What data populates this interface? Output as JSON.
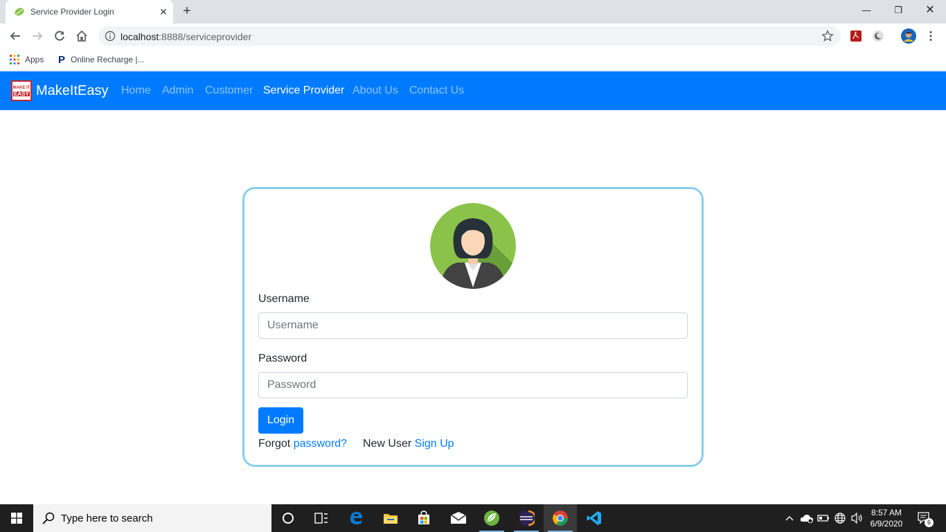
{
  "browser": {
    "tab_title": "Service Provider Login",
    "url_host": "localhost",
    "url_rest": ":8888/serviceprovider",
    "bookmarks": [
      {
        "label": "Apps"
      },
      {
        "label": "Online Recharge |..."
      }
    ]
  },
  "navbar": {
    "brand": "MakeItEasy",
    "logo_text_top": "MAKE IT",
    "logo_text_bottom": "EASY",
    "links": [
      {
        "label": "Home",
        "active": false
      },
      {
        "label": "Admin",
        "active": false
      },
      {
        "label": "Customer",
        "active": false
      },
      {
        "label": "Service Provider",
        "active": true
      },
      {
        "label": "About Us",
        "active": false
      },
      {
        "label": "Contact Us",
        "active": false
      }
    ]
  },
  "login": {
    "username_label": "Username",
    "username_placeholder": "Username",
    "username_value": "",
    "password_label": "Password",
    "password_placeholder": "Password",
    "password_value": "",
    "login_button": "Login",
    "forgot_prefix": "Forgot ",
    "forgot_link": "password?",
    "new_user_prefix": "New User ",
    "signup_link": "Sign Up"
  },
  "taskbar": {
    "search_placeholder": "Type here to search",
    "time": "8:57 AM",
    "date": "6/9/2020",
    "notification_count": "6"
  },
  "colors": {
    "navbar": "#007bff",
    "card_border": "#87ceeb",
    "link": "#007bff"
  }
}
